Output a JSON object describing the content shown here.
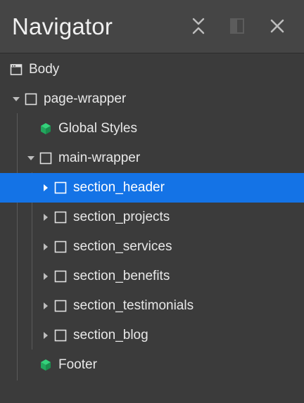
{
  "panel": {
    "title": "Navigator",
    "buttons": {
      "collapse_icon": "collapse-all-icon",
      "dock_icon": "dock-panel-icon",
      "close_icon": "close-icon"
    }
  },
  "tree": {
    "body": "Body",
    "page_wrapper": "page-wrapper",
    "global_styles": "Global Styles",
    "main_wrapper": "main-wrapper",
    "sections": [
      "section_header",
      "section_projects",
      "section_services",
      "section_benefits",
      "section_testimonials",
      "section_blog"
    ],
    "footer": "Footer"
  },
  "colors": {
    "selection": "#1473e6",
    "component": "#27c06b",
    "panel_bg": "#3b3b3b",
    "header_bg": "#454545"
  }
}
